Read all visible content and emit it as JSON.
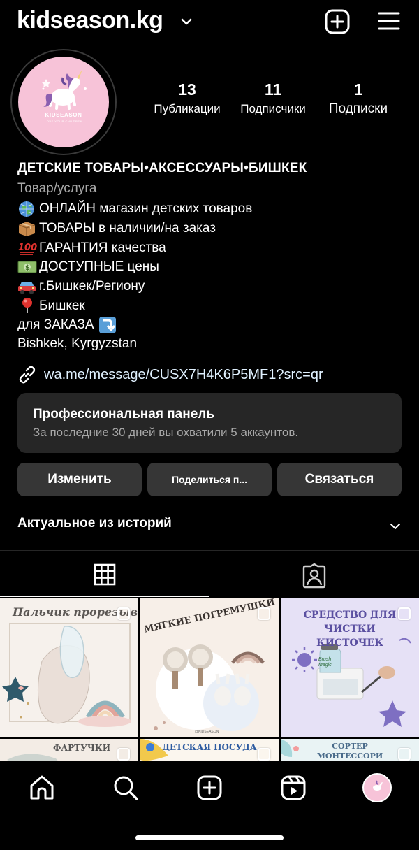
{
  "header": {
    "username": "kidseason.kg",
    "icons": [
      "chevron-down-icon",
      "plus-square-icon",
      "hamburger-menu-icon"
    ]
  },
  "avatar": {
    "brand": "KIDSEASON",
    "tagline": "LOVE  YOUR  CHILDREN"
  },
  "stats": [
    {
      "value": "13",
      "label": "Публикации"
    },
    {
      "value": "11",
      "label": "Подписчики"
    },
    {
      "value": "1",
      "label": "Подписки"
    }
  ],
  "bio": {
    "name": "ДЕТСКИЕ ТОВАРЫ•АКСЕССУАРЫ•БИШКЕК",
    "category": "Товар/услуга",
    "lines": [
      {
        "icon": "globe-emoji",
        "text": "ОНЛАЙН магазин детских товаров"
      },
      {
        "icon": "package-emoji",
        "text": "ТОВАРЫ в наличии/на заказ"
      },
      {
        "icon": "hundred-points-emoji",
        "text": "ГАРАНТИЯ качества"
      },
      {
        "icon": "dollar-banknote-emoji",
        "text": "ДОСТУПНЫЕ цены"
      },
      {
        "icon": "car-emoji",
        "text": "г.Бишкек/Региону"
      },
      {
        "icon": "round-pushpin-emoji",
        "text": "Бишкек"
      },
      {
        "icon": "arrow-down-emoji",
        "text": "для ЗАКАЗА"
      }
    ],
    "location": "Bishkek, Kyrgyzstan",
    "link": "wa.me/message/CUSX7H4K6P5MF1?src=qr"
  },
  "pro_panel": {
    "title": "Профессиональная панель",
    "subtitle": "За последние 30 дней вы охватили 5 аккаунтов."
  },
  "buttons": {
    "edit": "Изменить",
    "share": "Поделиться п...",
    "contact": "Связаться"
  },
  "highlights": {
    "label": "Актуальное из историй"
  },
  "tabs": [
    "grid-icon",
    "tagged-person-icon"
  ],
  "posts": [
    {
      "title": "Пальчик прорезыватель"
    },
    {
      "title": "МЯГКИЕ ПОГРЕМУШКИ",
      "watermark": "@KIDSEASON"
    },
    {
      "title": "СРЕДСТВО ДЛЯ ЧИСТКИ КИСТОЧЕК",
      "product": "Brush Magic"
    },
    {
      "title": "ФАРТУЧКИ"
    },
    {
      "title": "ДЕТСКАЯ ПОСУДА"
    },
    {
      "title": "СОРТЕР МОНТЕССОРИ"
    }
  ],
  "bottom_nav": [
    "home-icon",
    "search-icon",
    "create-icon",
    "reels-icon",
    "profile-avatar-icon"
  ],
  "colors": {
    "background": "#000000",
    "panel": "#262626",
    "button": "#363636",
    "secondary_text": "#a8a8a8",
    "link": "#e0f1ff",
    "avatar_pink": "#f7c3d8"
  }
}
